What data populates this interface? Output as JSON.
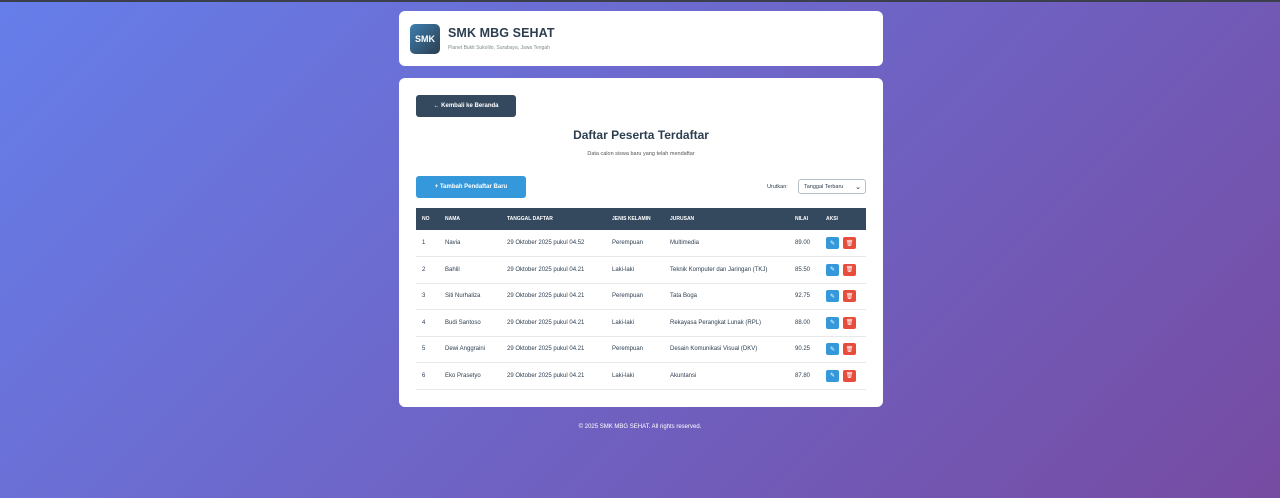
{
  "header": {
    "logo_text": "SMK",
    "school_name": "SMK MBG SEHAT",
    "address": "Planet Bukit Sukolilo, Surabaya, Jawa Tengah"
  },
  "main": {
    "back_label": "← Kembali ke Beranda",
    "title": "Daftar Peserta Terdaftar",
    "subtitle": "Data calon siswa baru yang telah mendaftar",
    "add_label": "+ Tambah Pendaftar Baru",
    "sort_label": "Urutkan:",
    "sort_value": "Tanggal Terbaru"
  },
  "table": {
    "headers": [
      "NO",
      "NAMA",
      "TANGGAL DAFTAR",
      "JENIS KELAMIN",
      "JURUSAN",
      "NILAI",
      "AKSI"
    ],
    "rows": [
      {
        "no": "1",
        "nama": "Navia",
        "tanggal": "29 Oktober 2025 pukul 04.52",
        "jk": "Perempuan",
        "jurusan": "Multimedia",
        "nilai": "89.00"
      },
      {
        "no": "2",
        "nama": "Bahlil",
        "tanggal": "29 Oktober 2025 pukul 04.21",
        "jk": "Laki-laki",
        "jurusan": "Teknik Komputer dan Jaringan (TKJ)",
        "nilai": "85.50"
      },
      {
        "no": "3",
        "nama": "Siti Nurhaliza",
        "tanggal": "29 Oktober 2025 pukul 04.21",
        "jk": "Perempuan",
        "jurusan": "Tata Boga",
        "nilai": "92.75"
      },
      {
        "no": "4",
        "nama": "Budi Santoso",
        "tanggal": "29 Oktober 2025 pukul 04.21",
        "jk": "Laki-laki",
        "jurusan": "Rekayasa Perangkat Lunak (RPL)",
        "nilai": "88.00"
      },
      {
        "no": "5",
        "nama": "Dewi Anggraini",
        "tanggal": "29 Oktober 2025 pukul 04.21",
        "jk": "Perempuan",
        "jurusan": "Desain Komunikasi Visual (DKV)",
        "nilai": "90.25"
      },
      {
        "no": "6",
        "nama": "Eko Prasetyo",
        "tanggal": "29 Oktober 2025 pukul 04.21",
        "jk": "Laki-laki",
        "jurusan": "Akuntansi",
        "nilai": "87.80"
      }
    ]
  },
  "icons": {
    "edit": "edit-icon",
    "delete": "trash-icon"
  },
  "colors": {
    "primary": "#3498db",
    "danger": "#e74c3c",
    "dark": "#34495e"
  },
  "footer": {
    "text": "© 2025 SMK MBG SEHAT. All rights reserved."
  }
}
